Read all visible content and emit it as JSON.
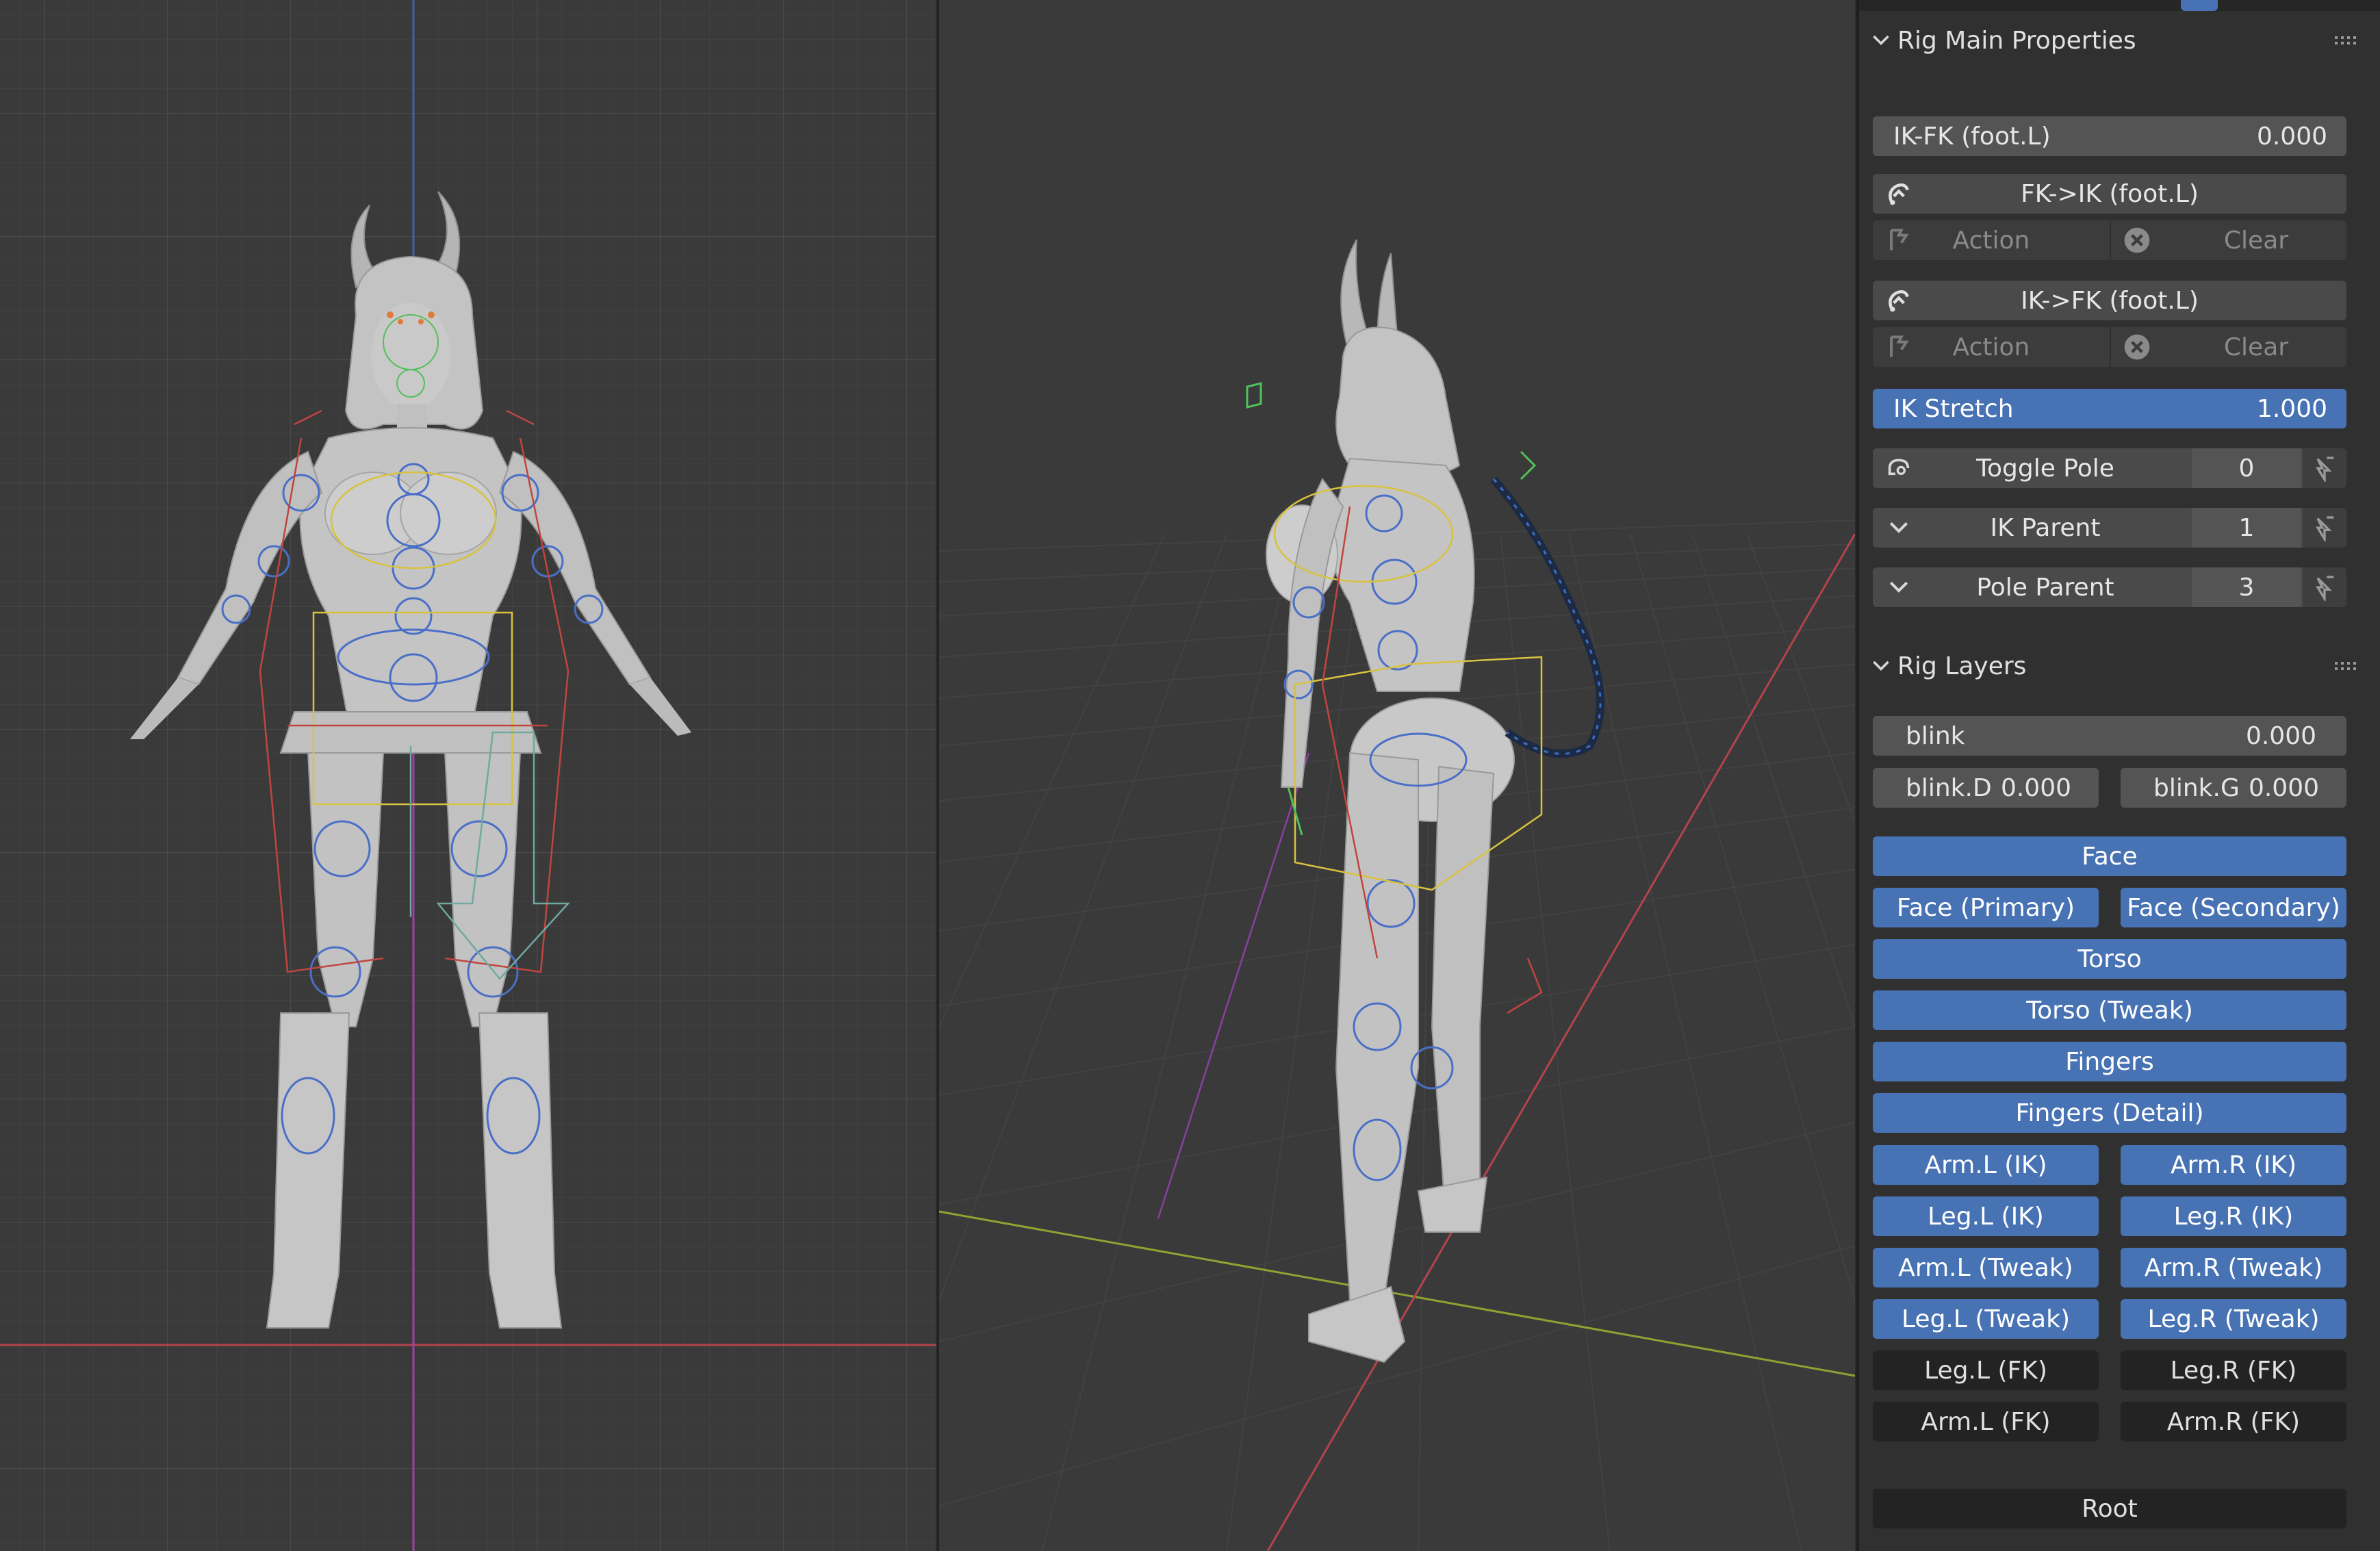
{
  "panel": {
    "rig_main": {
      "title": "Rig Main Properties",
      "ik_fk": {
        "label": "IK-FK (foot.L)",
        "value": "0.000"
      },
      "fk_to_ik": {
        "label": "FK->IK (foot.L)",
        "action": "Action",
        "clear": "Clear"
      },
      "ik_to_fk": {
        "label": "IK->FK (foot.L)",
        "action": "Action",
        "clear": "Clear"
      },
      "ik_stretch": {
        "label": "IK Stretch",
        "value": "1.000"
      },
      "toggle_pole": {
        "label": "Toggle Pole",
        "value": "0"
      },
      "ik_parent": {
        "label": "IK Parent",
        "value": "1"
      },
      "pole_parent": {
        "label": "Pole Parent",
        "value": "3"
      }
    },
    "rig_layers": {
      "title": "Rig Layers",
      "blink": {
        "label": "blink",
        "value": "0.000"
      },
      "blink_d": {
        "label": "blink.D",
        "value": "0.000"
      },
      "blink_g": {
        "label": "blink.G",
        "value": "0.000"
      },
      "face": "Face",
      "face_primary": "Face (Primary)",
      "face_secondary": "Face (Secondary)",
      "torso": "Torso",
      "torso_tweak": "Torso (Tweak)",
      "fingers": "Fingers",
      "fingers_detail": "Fingers (Detail)",
      "arm_l_ik": "Arm.L (IK)",
      "arm_r_ik": "Arm.R (IK)",
      "leg_l_ik": "Leg.L (IK)",
      "leg_r_ik": "Leg.R (IK)",
      "arm_l_tweak": "Arm.L (Tweak)",
      "arm_r_tweak": "Arm.R (Tweak)",
      "leg_l_tweak": "Leg.L (Tweak)",
      "leg_r_tweak": "Leg.R (Tweak)",
      "leg_l_fk": "Leg.L (FK)",
      "leg_r_fk": "Leg.R (FK)",
      "arm_l_fk": "Arm.L (FK)",
      "arm_r_fk": "Arm.R (FK)",
      "root": "Root"
    }
  },
  "colors": {
    "accent": "#4772b3",
    "panel_bg": "#303030",
    "viewport_bg": "#3a3a3a",
    "x_axis": "#c8464b",
    "y_axis": "#8cab2d",
    "z_axis": "#4a78c8",
    "mesh": "#bdbdbd"
  },
  "icons": {
    "run_script": "snap-icon",
    "disabled_action": "action-icon",
    "clear": "x-circle-icon",
    "toggle": "pole-toggle-icon",
    "dropdown": "chevron-down-icon",
    "keyframe": "pin-icon"
  }
}
